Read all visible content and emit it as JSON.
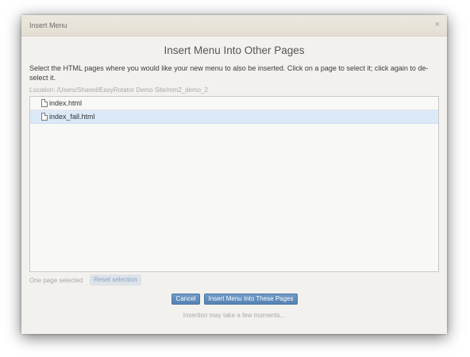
{
  "dialog": {
    "window_title": "Insert Menu",
    "close_symbol": "×",
    "heading": "Insert Menu Into Other Pages",
    "instructions": "Select the HTML pages where you would like your new menu to also be inserted.  Click on a page to select it; click again to de-select it.",
    "location": "Location: /Users/Shared/EasyRotator Demo Site/mm2_demo_2"
  },
  "files": [
    {
      "name": "index.html",
      "selected": false,
      "icon": "file-icon"
    },
    {
      "name": "index_fall.html",
      "selected": true,
      "icon": "file-icon"
    }
  ],
  "selection": {
    "status": "One page selected",
    "reset_label": "Reset selection"
  },
  "buttons": {
    "cancel_label": "Cancel",
    "insert_label": "Insert Menu Into These Pages"
  },
  "note": "Insertion may take a few moments...",
  "colors": {
    "selected_row": "#dbe9f9",
    "primary_button": "#5f8cbc",
    "disabled_button": "#dde3ea"
  }
}
